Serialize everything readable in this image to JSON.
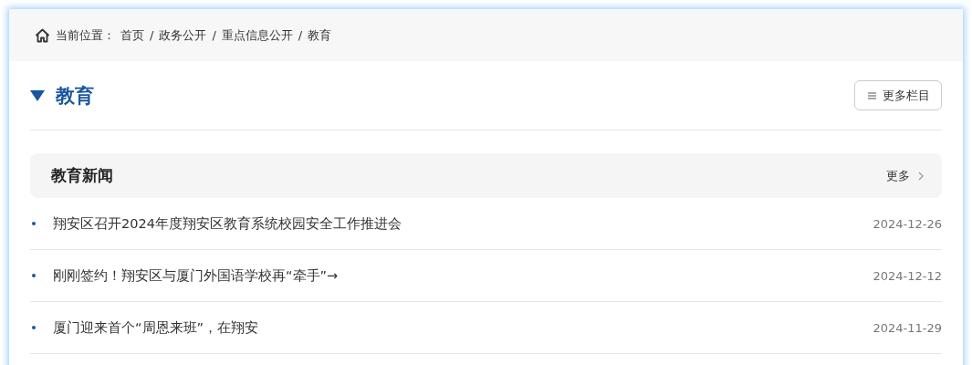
{
  "breadcrumb": {
    "label": "当前位置：",
    "separator": "/",
    "items": [
      {
        "text": "首页"
      },
      {
        "text": "政务公开"
      },
      {
        "text": "重点信息公开"
      },
      {
        "text": "教育"
      }
    ]
  },
  "heading": {
    "title": "教育",
    "more_button": "更多栏目"
  },
  "section": {
    "title": "教育新闻",
    "more_link": "更多"
  },
  "news": [
    {
      "title": "翔安区召开2024年度翔安区教育系统校园安全工作推进会",
      "date": "2024-12-26"
    },
    {
      "title": "刚刚签约！翔安区与厦门外国语学校再“牵手”→",
      "date": "2024-12-12"
    },
    {
      "title": "厦门迎来首个“周恩来班”，在翔安",
      "date": "2024-11-29"
    }
  ]
}
